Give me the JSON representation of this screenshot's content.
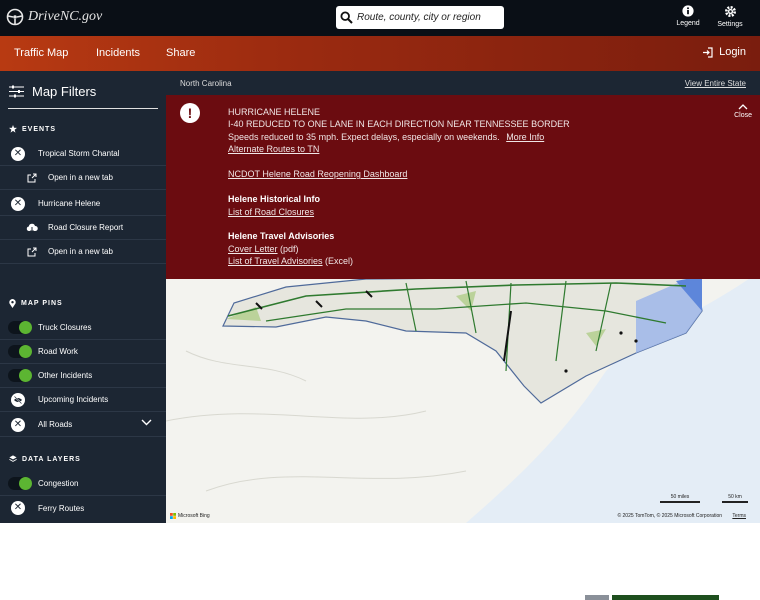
{
  "header": {
    "logo_text": "DriveNC.gov",
    "search_placeholder": "Route, county, city or region",
    "legend_label": "Legend",
    "settings_label": "Settings"
  },
  "nav": {
    "items": [
      "Traffic Map",
      "Incidents",
      "Share"
    ],
    "login_label": "Login"
  },
  "sidebar": {
    "title": "Map Filters",
    "events_title": "EVENTS",
    "events": [
      {
        "label": "Tropical Storm Chantal",
        "icon": "x-circle-icon"
      },
      {
        "label": "Open in a new tab",
        "icon": "external-link-icon"
      },
      {
        "label": "Hurricane Helene",
        "icon": "x-circle-icon"
      },
      {
        "label": "Road Closure Report",
        "icon": "cloud-download-icon"
      },
      {
        "label": "Open in a new tab",
        "icon": "external-link-icon"
      }
    ],
    "pins_title": "MAP PINS",
    "pins": [
      {
        "label": "Truck Closures",
        "state": "on"
      },
      {
        "label": "Road Work",
        "state": "on"
      },
      {
        "label": "Other Incidents",
        "state": "on"
      },
      {
        "label": "Upcoming Incidents",
        "state": "hidden"
      },
      {
        "label": "All Roads",
        "state": "off"
      }
    ],
    "layers_title": "DATA LAYERS",
    "layers": [
      {
        "label": "Congestion",
        "state": "on"
      },
      {
        "label": "Ferry Routes",
        "state": "off"
      }
    ]
  },
  "map": {
    "state_label": "North Carolina",
    "view_all_label": "View Entire State",
    "scale_miles": "50 miles",
    "scale_km": "50 km",
    "attribution": "© 2025 TomTom, © 2025 Microsoft Corporation",
    "terms": "Terms",
    "provider": "Microsoft Bing"
  },
  "alert": {
    "title": "HURRICANE HELENE",
    "headline": "I-40 REDUCED TO ONE LANE IN EACH DIRECTION NEAR TENNESSEE BORDER",
    "speeds": "Speeds reduced to 35 mph.  Expect delays, especially on weekends.",
    "more_info": "More Info",
    "alt_routes": "Alternate Routes to TN",
    "dashboard": "NCDOT Helene Road Reopening Dashboard",
    "historical_title": "Helene Historical Info",
    "road_closures": "List of Road Closures",
    "advisories_title": "Helene Travel Advisories",
    "cover_letter": "Cover Letter",
    "cover_letter_suffix": " (pdf)",
    "advisories_list": "List of Travel Advisories",
    "advisories_suffix": " (Excel)",
    "close_label": "Close"
  },
  "colors": {
    "topbar": "#0a0f16",
    "nav_start": "#b83a12",
    "sidebar": "#1c2633",
    "alert": "#6b0c10",
    "toggle_on": "#5cb532",
    "ocean": "#e6eef7"
  }
}
